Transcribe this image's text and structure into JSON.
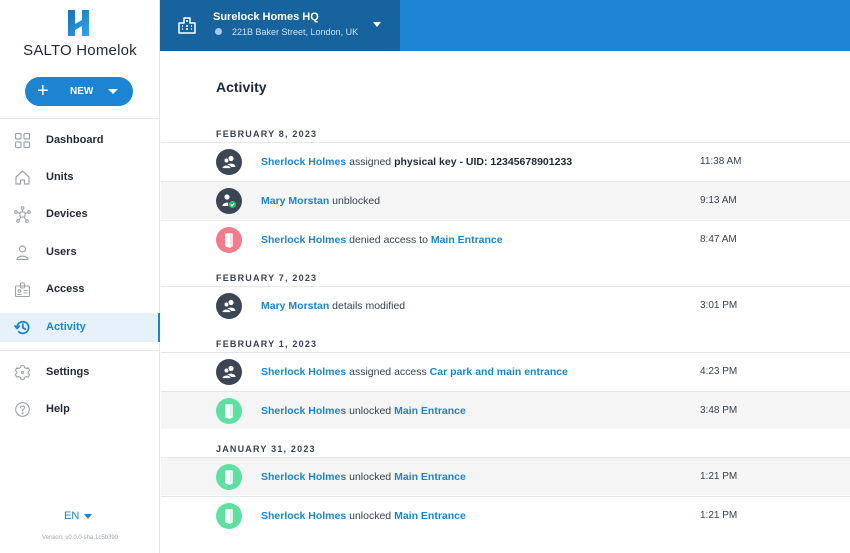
{
  "app": {
    "name": "SALTO Homelok",
    "brand_color": "#1b84d3"
  },
  "sidebar": {
    "new_button_label": "NEW",
    "items": [
      {
        "label": "Dashboard",
        "icon": "dashboard-icon",
        "active": false
      },
      {
        "label": "Units",
        "icon": "home-icon",
        "active": false
      },
      {
        "label": "Devices",
        "icon": "devices-icon",
        "active": false
      },
      {
        "label": "Users",
        "icon": "user-icon",
        "active": false
      },
      {
        "label": "Access",
        "icon": "access-badge-icon",
        "active": false
      },
      {
        "label": "Activity",
        "icon": "history-icon",
        "active": true
      }
    ],
    "bottom_items": [
      {
        "label": "Settings",
        "icon": "gear-icon"
      },
      {
        "label": "Help",
        "icon": "help-icon"
      }
    ],
    "language": "EN",
    "version": "Version: v0.0.0-sha.1c5b390"
  },
  "topbar": {
    "site_name": "Surelock Homes HQ",
    "site_address": "221B Baker Street, London, UK"
  },
  "main": {
    "title": "Activity",
    "groups": [
      {
        "date": "FEBRUARY 8, 2023",
        "events": [
          {
            "type": "user",
            "actor": "Sherlock Holmes",
            "action": "assigned",
            "object": "physical key - UID: 12345678901233",
            "object_style": "strong",
            "time": "11:38 AM"
          },
          {
            "type": "user-unblocked",
            "actor": "Mary Morstan",
            "action": "unblocked",
            "object": "",
            "time": "9:13 AM"
          },
          {
            "type": "denied",
            "actor": "Sherlock Holmes",
            "action": "denied access to",
            "object": "Main Entrance",
            "object_style": "link",
            "time": "8:47 AM"
          }
        ]
      },
      {
        "date": "FEBRUARY 7, 2023",
        "events": [
          {
            "type": "user",
            "actor": "Mary Morstan",
            "action": "details modified",
            "object": "",
            "time": "3:01 PM"
          }
        ]
      },
      {
        "date": "FEBRUARY 1, 2023",
        "events": [
          {
            "type": "user",
            "actor": "Sherlock Holmes",
            "action": "assigned access",
            "object": "Car park and main entrance",
            "object_style": "link",
            "time": "4:23 PM"
          },
          {
            "type": "unlock",
            "actor": "Sherlock Holmes",
            "action": "unlocked",
            "object": "Main Entrance",
            "object_style": "link",
            "time": "3:48 PM"
          }
        ]
      },
      {
        "date": "JANUARY 31, 2023",
        "events": [
          {
            "type": "unlock",
            "actor": "Sherlock Holmes",
            "action": "unlocked",
            "object": "Main Entrance",
            "object_style": "link",
            "time": "1:21 PM"
          },
          {
            "type": "unlock",
            "actor": "Sherlock Holmes",
            "action": "unlocked",
            "object": "Main Entrance",
            "object_style": "link",
            "time": "1:21 PM"
          }
        ]
      }
    ]
  }
}
